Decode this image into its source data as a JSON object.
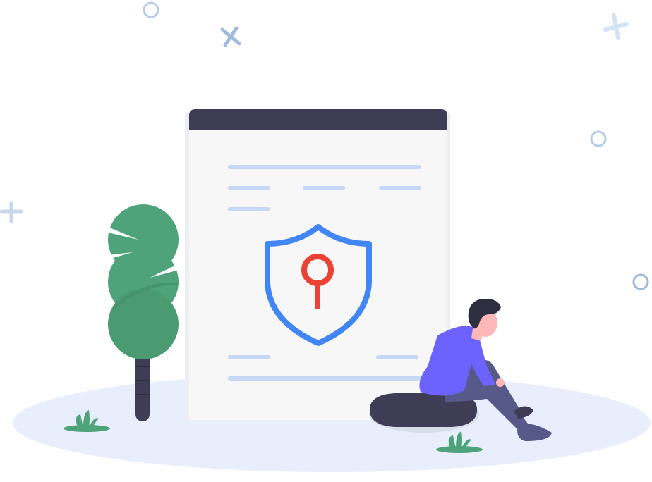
{
  "illustration": {
    "subject": "security-shield-with-key-document",
    "colors": {
      "ground": "#e8eefb",
      "document_header": "#3f3d56",
      "document_body": "#f7f7f7",
      "text_lines": "#c7d7f6",
      "shield_outline": "#4285f4",
      "keyhole": "#ea4335",
      "tree_leaf": "#4fa37b",
      "tree_trunk": "#3f3d56",
      "person_shirt": "#6c63ff",
      "person_pants": "#575a89",
      "person_skin": "#ffb8b8",
      "person_hair": "#2f2e41",
      "rock": "#3f3d56",
      "grass": "#4fa37b",
      "decor_circle": "#a9c2e6",
      "decor_cross": "#a9c2e6"
    },
    "icons": [
      "shield-icon",
      "keyhole-icon",
      "tree-icon",
      "person-icon",
      "rock-icon",
      "grass-icon",
      "circle-decor-icon",
      "cross-decor-icon"
    ]
  }
}
